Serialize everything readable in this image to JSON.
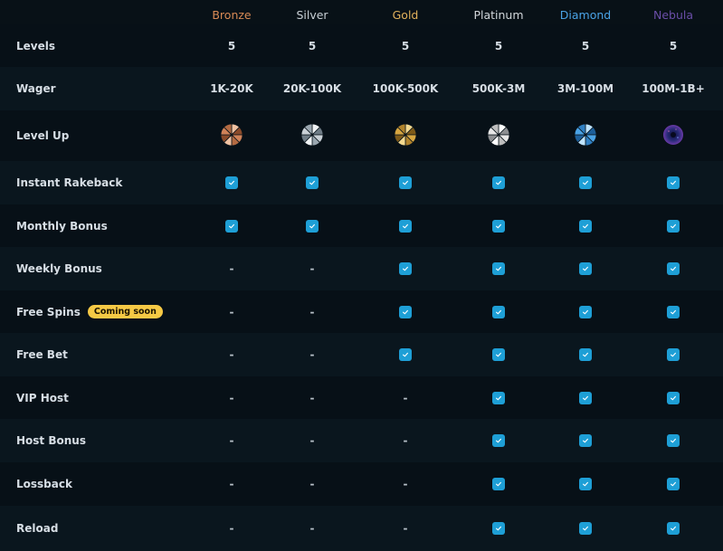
{
  "tiers": [
    {
      "name": "Bronze",
      "color": "#d98a55",
      "medal": "bronze-medal-icon"
    },
    {
      "name": "Silver",
      "color": "#c9d0d6",
      "medal": "silver-medal-icon"
    },
    {
      "name": "Gold",
      "color": "#e2b25c",
      "medal": "gold-medal-icon"
    },
    {
      "name": "Platinum",
      "color": "#d3d8dc",
      "medal": "platinum-medal-icon"
    },
    {
      "name": "Diamond",
      "color": "#4aa3e6",
      "medal": "diamond-medal-icon"
    },
    {
      "name": "Nebula",
      "color": "#6a4ea8",
      "medal": "nebula-medal-icon"
    }
  ],
  "rows": [
    {
      "label": "Levels",
      "type": "text",
      "values": [
        "5",
        "5",
        "5",
        "5",
        "5",
        "5"
      ]
    },
    {
      "label": "Wager",
      "type": "text",
      "values": [
        "1K-20K",
        "20K-100K",
        "100K-500K",
        "500K-3M",
        "3M-100M",
        "100M-1B+"
      ]
    },
    {
      "label": "Level Up",
      "type": "medal"
    },
    {
      "label": "Instant Rakeback",
      "type": "check",
      "values": [
        true,
        true,
        true,
        true,
        true,
        true
      ]
    },
    {
      "label": "Monthly Bonus",
      "type": "check",
      "values": [
        true,
        true,
        true,
        true,
        true,
        true
      ]
    },
    {
      "label": "Weekly Bonus",
      "type": "check",
      "values": [
        false,
        false,
        true,
        true,
        true,
        true
      ]
    },
    {
      "label": "Free Spins",
      "badge": "Coming soon",
      "type": "check",
      "values": [
        false,
        false,
        true,
        true,
        true,
        true
      ]
    },
    {
      "label": "Free Bet",
      "type": "check",
      "values": [
        false,
        false,
        true,
        true,
        true,
        true
      ]
    },
    {
      "label": "VIP Host",
      "type": "check",
      "values": [
        false,
        false,
        false,
        true,
        true,
        true
      ]
    },
    {
      "label": "Host Bonus",
      "type": "check",
      "values": [
        false,
        false,
        false,
        true,
        true,
        true
      ]
    },
    {
      "label": "Lossback",
      "type": "check",
      "values": [
        false,
        false,
        false,
        true,
        true,
        true
      ]
    },
    {
      "label": "Reload",
      "type": "check",
      "values": [
        false,
        false,
        false,
        true,
        true,
        true
      ]
    }
  ],
  "dash_symbol": "-",
  "check_color": "#1e9fd6",
  "badge_color": "#f6c945"
}
